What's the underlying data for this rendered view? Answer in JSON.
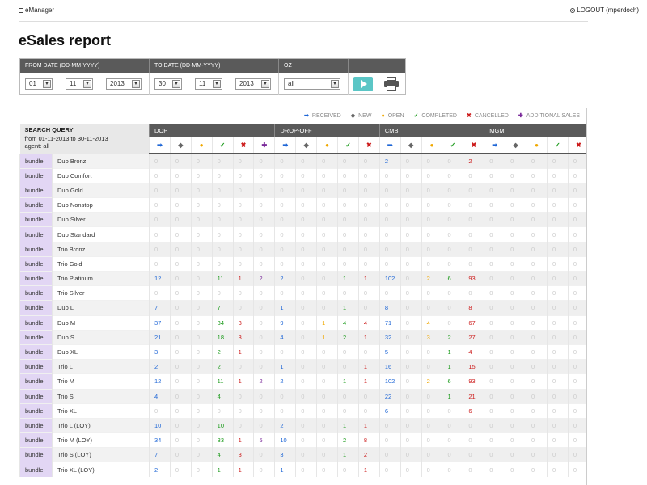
{
  "app": {
    "brand": "eManager",
    "logout": "LOGOUT (mperdoch)",
    "title": "eSales report"
  },
  "filters": {
    "headers": [
      "FROM DATE (DD-MM-YYYY)",
      "TO DATE (DD-MM-YYYY)",
      "OZ",
      ""
    ],
    "from_day": "01",
    "from_month": "11",
    "from_year": "2013",
    "to_day": "30",
    "to_month": "11",
    "to_year": "2013",
    "oz": "all"
  },
  "legend": [
    {
      "icon": "➡",
      "label": "RECEIVED",
      "cls": "c-rec",
      "icon_name": "received-arrow-icon"
    },
    {
      "icon": "◆",
      "label": "NEW",
      "cls": "c-new",
      "icon_name": "new-diamond-icon"
    },
    {
      "icon": "●",
      "label": "OPEN",
      "cls": "c-open",
      "icon_name": "open-dot-icon"
    },
    {
      "icon": "✓",
      "label": "COMPLETED",
      "cls": "c-comp",
      "icon_name": "completed-check-icon"
    },
    {
      "icon": "✖",
      "label": "CANCELLED",
      "cls": "c-can",
      "icon_name": "cancelled-x-icon"
    },
    {
      "icon": "✚",
      "label": "ADDITIONAL SALES",
      "cls": "c-add",
      "icon_name": "additional-plus-icon"
    }
  ],
  "search": {
    "title": "SEARCH QUERY",
    "range": "from 01-11-2013 to 30-11-2013",
    "agent": "agent: all"
  },
  "groups": [
    {
      "name": "DOP",
      "cols": [
        "rec",
        "new",
        "open",
        "comp",
        "can",
        "add"
      ]
    },
    {
      "name": "DROP-OFF",
      "cols": [
        "rec",
        "new",
        "open",
        "comp",
        "can"
      ]
    },
    {
      "name": "CMB",
      "cols": [
        "rec",
        "new",
        "open",
        "comp",
        "can"
      ]
    },
    {
      "name": "MGM",
      "cols": [
        "rec",
        "new",
        "open",
        "comp",
        "can"
      ]
    }
  ],
  "rows": [
    {
      "type": "bundle",
      "name": "Duo Bronz",
      "v": [
        0,
        0,
        0,
        0,
        0,
        0,
        0,
        0,
        0,
        0,
        0,
        2,
        0,
        0,
        0,
        2,
        0,
        0,
        0,
        0,
        0
      ]
    },
    {
      "type": "bundle",
      "name": "Duo Comfort",
      "v": [
        0,
        0,
        0,
        0,
        0,
        0,
        0,
        0,
        0,
        0,
        0,
        0,
        0,
        0,
        0,
        0,
        0,
        0,
        0,
        0,
        0
      ]
    },
    {
      "type": "bundle",
      "name": "Duo Gold",
      "v": [
        0,
        0,
        0,
        0,
        0,
        0,
        0,
        0,
        0,
        0,
        0,
        0,
        0,
        0,
        0,
        0,
        0,
        0,
        0,
        0,
        0
      ]
    },
    {
      "type": "bundle",
      "name": "Duo Nonstop",
      "v": [
        0,
        0,
        0,
        0,
        0,
        0,
        0,
        0,
        0,
        0,
        0,
        0,
        0,
        0,
        0,
        0,
        0,
        0,
        0,
        0,
        0
      ]
    },
    {
      "type": "bundle",
      "name": "Duo Silver",
      "v": [
        0,
        0,
        0,
        0,
        0,
        0,
        0,
        0,
        0,
        0,
        0,
        0,
        0,
        0,
        0,
        0,
        0,
        0,
        0,
        0,
        0
      ]
    },
    {
      "type": "bundle",
      "name": "Duo Standard",
      "v": [
        0,
        0,
        0,
        0,
        0,
        0,
        0,
        0,
        0,
        0,
        0,
        0,
        0,
        0,
        0,
        0,
        0,
        0,
        0,
        0,
        0
      ]
    },
    {
      "type": "bundle",
      "name": "Trio Bronz",
      "v": [
        0,
        0,
        0,
        0,
        0,
        0,
        0,
        0,
        0,
        0,
        0,
        0,
        0,
        0,
        0,
        0,
        0,
        0,
        0,
        0,
        0
      ]
    },
    {
      "type": "bundle",
      "name": "Trio Gold",
      "v": [
        0,
        0,
        0,
        0,
        0,
        0,
        0,
        0,
        0,
        0,
        0,
        0,
        0,
        0,
        0,
        0,
        0,
        0,
        0,
        0,
        0
      ]
    },
    {
      "type": "bundle",
      "name": "Trio Platinum",
      "v": [
        12,
        0,
        0,
        11,
        1,
        2,
        2,
        0,
        0,
        1,
        1,
        102,
        0,
        2,
        6,
        93,
        0,
        0,
        0,
        0,
        0
      ]
    },
    {
      "type": "bundle",
      "name": "Trio Silver",
      "v": [
        0,
        0,
        0,
        0,
        0,
        0,
        0,
        0,
        0,
        0,
        0,
        0,
        0,
        0,
        0,
        0,
        0,
        0,
        0,
        0,
        0
      ]
    },
    {
      "type": "bundle",
      "name": "Duo L",
      "v": [
        7,
        0,
        0,
        7,
        0,
        0,
        1,
        0,
        0,
        1,
        0,
        8,
        0,
        0,
        0,
        8,
        0,
        0,
        0,
        0,
        0
      ]
    },
    {
      "type": "bundle",
      "name": "Duo M",
      "v": [
        37,
        0,
        0,
        34,
        3,
        0,
        9,
        0,
        1,
        4,
        4,
        71,
        0,
        4,
        0,
        67,
        0,
        0,
        0,
        0,
        0
      ]
    },
    {
      "type": "bundle",
      "name": "Duo S",
      "v": [
        21,
        0,
        0,
        18,
        3,
        0,
        4,
        0,
        1,
        2,
        1,
        32,
        0,
        3,
        2,
        27,
        0,
        0,
        0,
        0,
        0
      ]
    },
    {
      "type": "bundle",
      "name": "Duo XL",
      "v": [
        3,
        0,
        0,
        2,
        1,
        0,
        0,
        0,
        0,
        0,
        0,
        5,
        0,
        0,
        1,
        4,
        0,
        0,
        0,
        0,
        0
      ]
    },
    {
      "type": "bundle",
      "name": "Trio L",
      "v": [
        2,
        0,
        0,
        2,
        0,
        0,
        1,
        0,
        0,
        0,
        1,
        16,
        0,
        0,
        1,
        15,
        0,
        0,
        0,
        0,
        0
      ]
    },
    {
      "type": "bundle",
      "name": "Trio M",
      "v": [
        12,
        0,
        0,
        11,
        1,
        2,
        2,
        0,
        0,
        1,
        1,
        102,
        0,
        2,
        6,
        93,
        0,
        0,
        0,
        0,
        0
      ]
    },
    {
      "type": "bundle",
      "name": "Trio S",
      "v": [
        4,
        0,
        0,
        4,
        0,
        0,
        0,
        0,
        0,
        0,
        0,
        22,
        0,
        0,
        1,
        21,
        0,
        0,
        0,
        0,
        0
      ]
    },
    {
      "type": "bundle",
      "name": "Trio XL",
      "v": [
        0,
        0,
        0,
        0,
        0,
        0,
        0,
        0,
        0,
        0,
        0,
        6,
        0,
        0,
        0,
        6,
        0,
        0,
        0,
        0,
        0
      ]
    },
    {
      "type": "bundle",
      "name": "Trio L (LOY)",
      "v": [
        10,
        0,
        0,
        10,
        0,
        0,
        2,
        0,
        0,
        1,
        1,
        0,
        0,
        0,
        0,
        0,
        0,
        0,
        0,
        0,
        0
      ]
    },
    {
      "type": "bundle",
      "name": "Trio M (LOY)",
      "v": [
        34,
        0,
        0,
        33,
        1,
        5,
        10,
        0,
        0,
        2,
        8,
        0,
        0,
        0,
        0,
        0,
        0,
        0,
        0,
        0,
        0
      ]
    },
    {
      "type": "bundle",
      "name": "Trio S (LOY)",
      "v": [
        7,
        0,
        0,
        4,
        3,
        0,
        3,
        0,
        0,
        1,
        2,
        0,
        0,
        0,
        0,
        0,
        0,
        0,
        0,
        0,
        0
      ]
    },
    {
      "type": "bundle",
      "name": "Trio XL (LOY)",
      "v": [
        2,
        0,
        0,
        1,
        1,
        0,
        1,
        0,
        0,
        0,
        1,
        0,
        0,
        0,
        0,
        0,
        0,
        0,
        0,
        0,
        0
      ]
    }
  ]
}
